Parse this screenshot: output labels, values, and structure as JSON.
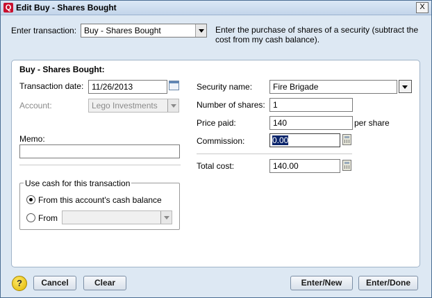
{
  "window": {
    "title": "Edit Buy - Shares Bought",
    "close_glyph": "X",
    "app_icon_letter": "Q"
  },
  "transaction_selector": {
    "label": "Enter transaction:",
    "selected": "Buy - Shares Bought"
  },
  "description": "Enter the purchase of shares of a security (subtract the cost from my cash balance).",
  "form": {
    "section_title": "Buy - Shares Bought:",
    "transaction_date": {
      "label": "Transaction date:",
      "value": "11/26/2013"
    },
    "account": {
      "label": "Account:",
      "value": "Lego Investments"
    },
    "memo": {
      "label": "Memo:",
      "value": ""
    },
    "security_name": {
      "label": "Security name:",
      "value": "Fire Brigade"
    },
    "number_of_shares": {
      "label": "Number of shares:",
      "value": "1"
    },
    "price_paid": {
      "label": "Price paid:",
      "value": "140",
      "suffix": "per share"
    },
    "commission": {
      "label": "Commission:",
      "value": "0.00"
    },
    "total_cost": {
      "label": "Total cost:",
      "value": "140.00"
    }
  },
  "cash_group": {
    "title": "Use cash for this transaction",
    "option_this_account": "From this account's cash balance",
    "option_from": "From",
    "from_account_value": ""
  },
  "buttons": {
    "help": "?",
    "cancel": "Cancel",
    "clear": "Clear",
    "enter_new": "Enter/New",
    "enter_done": "Enter/Done"
  }
}
